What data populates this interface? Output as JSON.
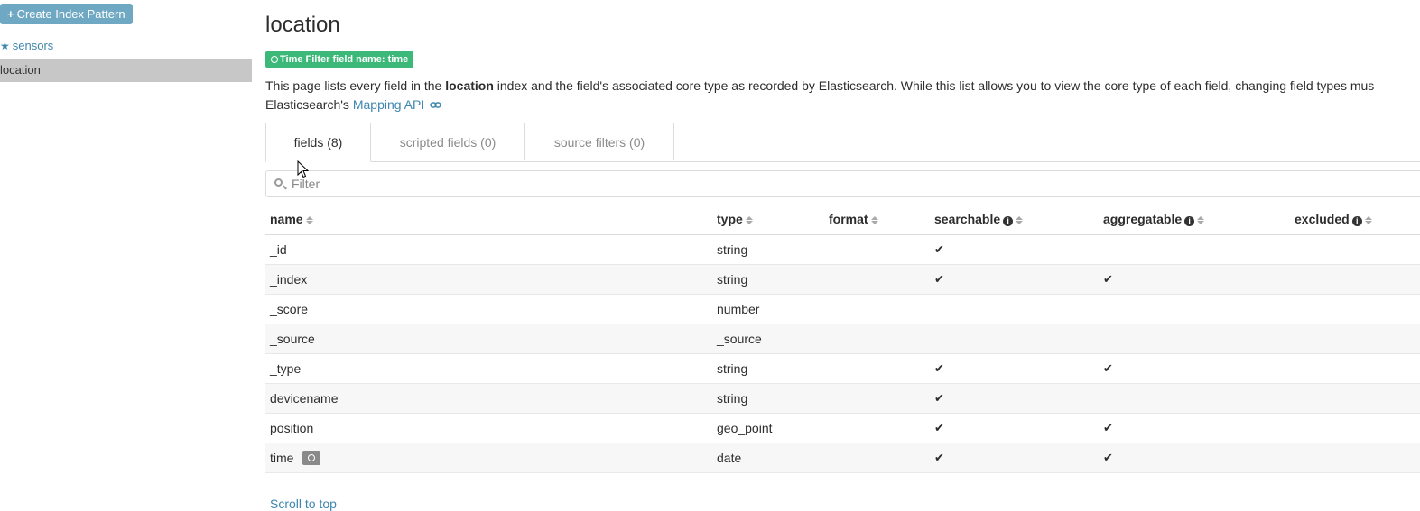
{
  "sidebar": {
    "create_button": "Create Index Pattern",
    "items": [
      {
        "label": "sensors",
        "icon": "star-icon",
        "starred": true
      },
      {
        "label": "location",
        "selected": true
      }
    ]
  },
  "main": {
    "title": "location",
    "time_badge": "Time Filter field name: time",
    "desc_part1": "This page lists every field in the ",
    "desc_bold": "location",
    "desc_part2": " index and the field's associated core type as recorded by Elasticsearch. While this list allows you to view the core type of each field, changing field types mus",
    "desc_part3": "Elasticsearch's ",
    "desc_link": "Mapping API",
    "tabs": [
      {
        "label": "fields (8)",
        "active": true
      },
      {
        "label": "scripted fields (0)",
        "active": false
      },
      {
        "label": "source filters (0)",
        "active": false
      }
    ],
    "filter_placeholder": "Filter",
    "columns": [
      "name",
      "type",
      "format",
      "searchable",
      "aggregatable",
      "excluded"
    ],
    "rows": [
      {
        "name": "_id",
        "type": "string",
        "searchable": true,
        "aggregatable": false
      },
      {
        "name": "_index",
        "type": "string",
        "searchable": true,
        "aggregatable": true
      },
      {
        "name": "_score",
        "type": "number",
        "searchable": false,
        "aggregatable": false
      },
      {
        "name": "_source",
        "type": "_source",
        "searchable": false,
        "aggregatable": false
      },
      {
        "name": "_type",
        "type": "string",
        "searchable": true,
        "aggregatable": true
      },
      {
        "name": "devicename",
        "type": "string",
        "searchable": true,
        "aggregatable": false
      },
      {
        "name": "position",
        "type": "geo_point",
        "searchable": true,
        "aggregatable": true
      },
      {
        "name": "time",
        "type": "date",
        "searchable": true,
        "aggregatable": true,
        "time_field": true
      }
    ],
    "check_mark": "✔",
    "scroll_to_top": "Scroll to top"
  },
  "colors": {
    "accent_link": "#3f86ae",
    "create_button_bg": "#6fa8c2",
    "time_badge_bg": "#3cb879",
    "selected_item_bg": "#c7c7c7"
  }
}
